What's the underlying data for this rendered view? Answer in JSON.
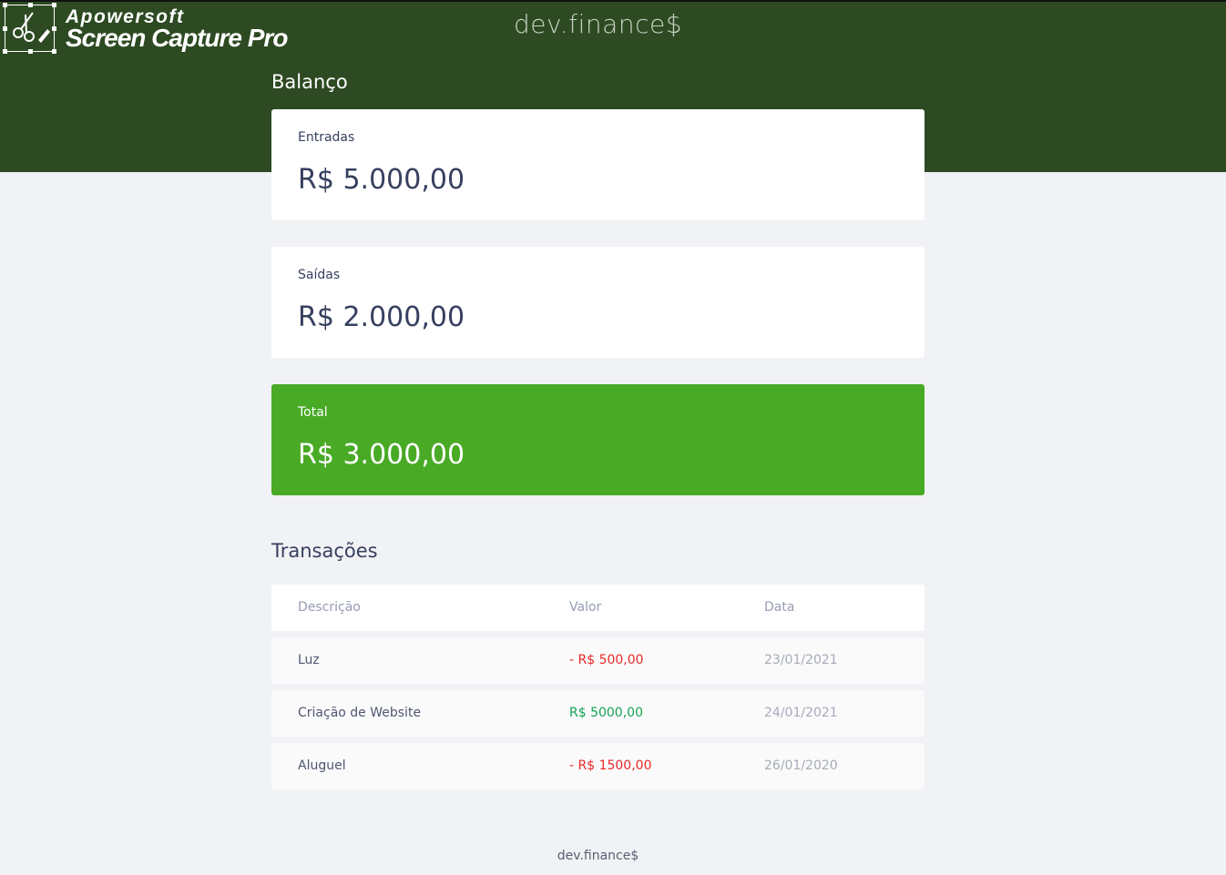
{
  "app": {
    "title": "dev.finance$",
    "footer": "dev.finance$"
  },
  "watermark": {
    "brand": "Apowersoft",
    "product": "Screen Capture Pro"
  },
  "balance": {
    "title": "Balanço",
    "cards": {
      "income": {
        "label": "Entradas",
        "value": "R$ 5.000,00"
      },
      "expense": {
        "label": "Saídas",
        "value": "R$ 2.000,00"
      },
      "total": {
        "label": "Total",
        "value": "R$ 3.000,00"
      }
    }
  },
  "transactions": {
    "title": "Transações",
    "columns": {
      "description": "Descrição",
      "amount": "Valor",
      "date": "Data"
    },
    "rows": [
      {
        "description": "Luz",
        "amount": "- R$ 500,00",
        "type": "expense",
        "date": "23/01/2021"
      },
      {
        "description": "Criação de Website",
        "amount": "R$ 5000,00",
        "type": "income",
        "date": "24/01/2021"
      },
      {
        "description": "Aluguel",
        "amount": "- R$ 1500,00",
        "type": "expense",
        "date": "26/01/2020"
      }
    ]
  },
  "colors": {
    "header_bg": "#2d4a22",
    "total_card_bg": "#49aa26",
    "expense": "#e92929",
    "income": "#12a454",
    "page_bg": "#f0f2f5"
  },
  "icons": {
    "watermark_logo": "scissors-pen-icon"
  }
}
